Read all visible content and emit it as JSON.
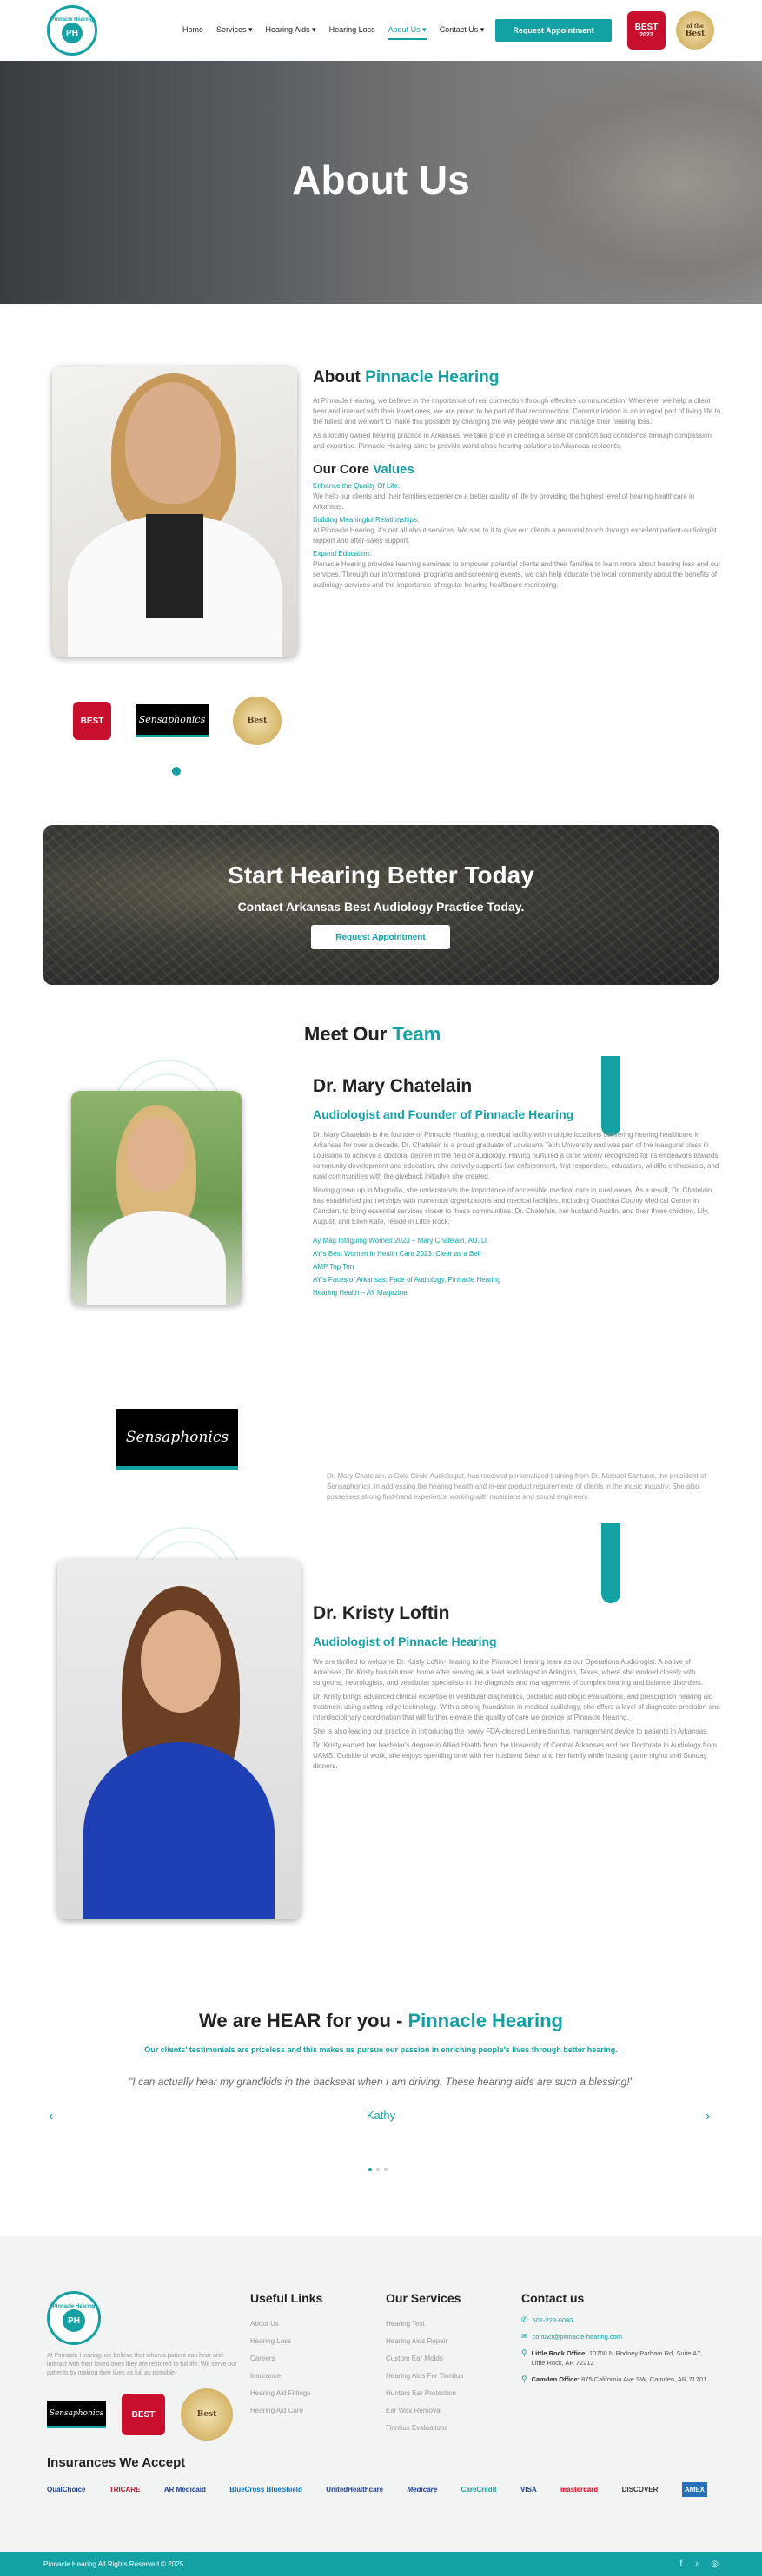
{
  "header": {
    "logo_text": "PH",
    "logo_ring": "Pinnacle Hearing",
    "nav": [
      {
        "label": "Home"
      },
      {
        "label": "Services ▾"
      },
      {
        "label": "Hearing Aids ▾"
      },
      {
        "label": "Hearing Loss"
      },
      {
        "label": "About Us ▾"
      },
      {
        "label": "Contact Us ▾"
      }
    ],
    "cta": "Request Appointment",
    "badge_best": "BEST",
    "badge_best_sub": "2023",
    "badge_gold": "Best",
    "badge_gold_sub": "of the"
  },
  "hero": {
    "title": "About Us"
  },
  "about": {
    "title_a": "About ",
    "title_b": "Pinnacle Hearing",
    "p1": "At Pinnacle Hearing, we believe in the importance of real connection through effective communication. Whenever we help a client hear and interact with their loved ones, we are proud to be part of that reconnection. Communication is an integral part of living life to the fullest and we want to make this possible by changing the way people view and manage their hearing loss.",
    "p2": "As a locally owned hearing practice in Arkansas, we take pride in creating a sense of comfort and confidence through compassion and expertise. Pinnacle Hearing aims to provide world class hearing solutions to Arkansas residents.",
    "values_a": "Our Core ",
    "values_b": "Values",
    "v1_title": "Enhance the Quality Of Life:",
    "v1_text": "We help our clients and their families experience a better quality of life by providing the highest level of hearing healthcare in Arkansas.",
    "v2_title": "Building Meaningful Relationships:",
    "v2_text": "At Pinnacle Hearing, it's not all about services. We see to it to give our clients a personal touch through excellent patient-audiologist rapport and after-sales support.",
    "v3_title": "Expand Education:",
    "v3_text": "Pinnacle Hearing provides learning seminars to empower potential clients and their families to learn more about hearing loss and our services. Through our informational programs and screening events, we can help educate the local community about the benefits of audiology services and the importance of regular hearing healthcare monitoring.",
    "sensaphonics": "Sensaphonics"
  },
  "cta": {
    "title": "Start Hearing Better Today",
    "subtitle": "Contact Arkansas Best Audiology Practice Today.",
    "button": "Request Appointment"
  },
  "team": {
    "title_a": "Meet Our ",
    "title_b": "Team",
    "mary": {
      "name": "Dr. Mary Chatelain",
      "role": "Audiologist and Founder of Pinnacle Hearing",
      "p1": "Dr. Mary Chatelain is the founder of Pinnacle Hearing, a medical facility with multiple locations delivering hearing healthcare in Arkansas for over a decade. Dr. Chatelain is a proud graduate of Louisiana Tech University and was part of the inaugural class in Louisiana to achieve a doctoral degree in the field of audiology. Having nurtured a clinic widely recognized for its endeavors towards community development and education, she actively supports law enforcement, first responders, educators, wildlife enthusiasts, and rural communities with the giveback initiative she created.",
      "p2": "Having grown up in Magnolia, she understands the importance of accessible medical care in rural areas. As a result, Dr. Chatelain has established partnerships with numerous organizations and medical facilities, including Ouachita County Medical Center in Camden, to bring essential services closer to these communities. Dr. Chatelain, her husband Austin, and their three children, Lily, August, and Ellen Kate, reside in Little Rock.",
      "awards": [
        "Ay Mag Intriguing Women 2023 – Mary Chatelain, AU. D.",
        "AY's Best Women in Health Care 2023: Clear as a Bell",
        "AMP Top Ten",
        "AY's Faces of Arkansas: Face of Audiology, Pinnacle Hearing",
        "Hearing Health – AY Magazine"
      ],
      "extra": "Dr. Mary Chatelain, a Gold Circle Audiologist, has received personalized training from Dr. Michael Santucci, the president of Sensaphonics, in addressing the hearing health and in-ear product requirements of clients in the music industry. She also possesses strong first-hand experience working with musicians and sound engineers.",
      "sensaphonics": "Sensaphonics"
    },
    "kristy": {
      "name": "Dr. Kristy Loftin",
      "role": "Audiologist of Pinnacle Hearing",
      "p1": "We are thrilled to welcome Dr. Kristy Loftin-Hearing to the Pinnacle Hearing team as our Operations Audiologist. A native of Arkansas, Dr. Kristy has returned home after serving as a lead audiologist in Arlington, Texas, where she worked closely with surgeons, neurologists, and vestibular specialists in the diagnosis and management of complex hearing and balance disorders.",
      "p2": "Dr. Kristy brings advanced clinical expertise in vestibular diagnostics, pediatric audiologic evaluations, and prescription hearing aid treatment using cutting-edge technology. With a strong foundation in medical audiology, she offers a level of diagnostic precision and interdisciplinary coordination that will further elevate the quality of care we provide at Pinnacle Hearing.",
      "p3": "She is also leading our practice in introducing the newly FDA-cleared Lenire tinnitus management device to patients in Arkansas.",
      "p4": "Dr. Kristy earned her bachelor's degree in Allied Health from the University of Central Arkansas and her Doctorate in Audiology from UAMS. Outside of work, she enjoys spending time with her husband Sean and her family while hosting game nights and Sunday dinners."
    }
  },
  "testimonials": {
    "title_a": "We are HEAR for you - ",
    "title_b": "Pinnacle Hearing",
    "tagline": "Our clients' testimonials are priceless and this makes us pursue our passion in enriching people's lives through better hearing.",
    "quote": "\"I can actually hear my grandkids in the backseat when I am driving. These hearing aids are such a blessing!\"",
    "author": "Kathy",
    "prev": "‹",
    "next": "›"
  },
  "footer": {
    "logo_text": "PH",
    "logo_ring": "Pinnacle Hearing",
    "about_text": "At Pinnacle Hearing, we believe that when a patient can hear and interact with their loved ones they are restored to full life. We serve our patients by making their lives as full as possible.",
    "useful_title": "Useful Links",
    "useful_links": [
      "About Us",
      "Hearing Loss",
      "Careers",
      "Insurance",
      "Hearing Aid Fittings",
      "Hearing Aid Care"
    ],
    "services_title": "Our Services",
    "services_links": [
      "Hearing Test",
      "Hearing Aids Repair",
      "Custom Ear Molds",
      "Hearing Aids For Tinnitus",
      "Hunters Ear Protection",
      "Ear Wax Removal",
      "Tinnitus Evaluations"
    ],
    "contact_title": "Contact us",
    "phone": "501-223-6080",
    "email": "contact@pinnacle-hearing.com",
    "office1_label": "Little Rock Office:",
    "office1": "10700 N Rodney Parham Rd, Suite A7, Little Rock, AR 72212",
    "office2_label": "Camden Office:",
    "office2": "875 California Ave SW, Camden, AR 71701",
    "insurance_title": "Insurances We Accept",
    "insurers": [
      "QualChoice",
      "TRICARE",
      "AR Medicaid",
      "BlueCross BlueShield",
      "UnitedHealthcare",
      "Medicare",
      "CareCredit",
      "VISA",
      "mastercard",
      "DISCOVER",
      "AMEX"
    ],
    "copyright": "Pinnacle Hearing All Rights Reserved © 2025",
    "socials": [
      "f",
      "♪",
      "◎"
    ]
  },
  "colors": {
    "accent": "#13a1a4"
  }
}
